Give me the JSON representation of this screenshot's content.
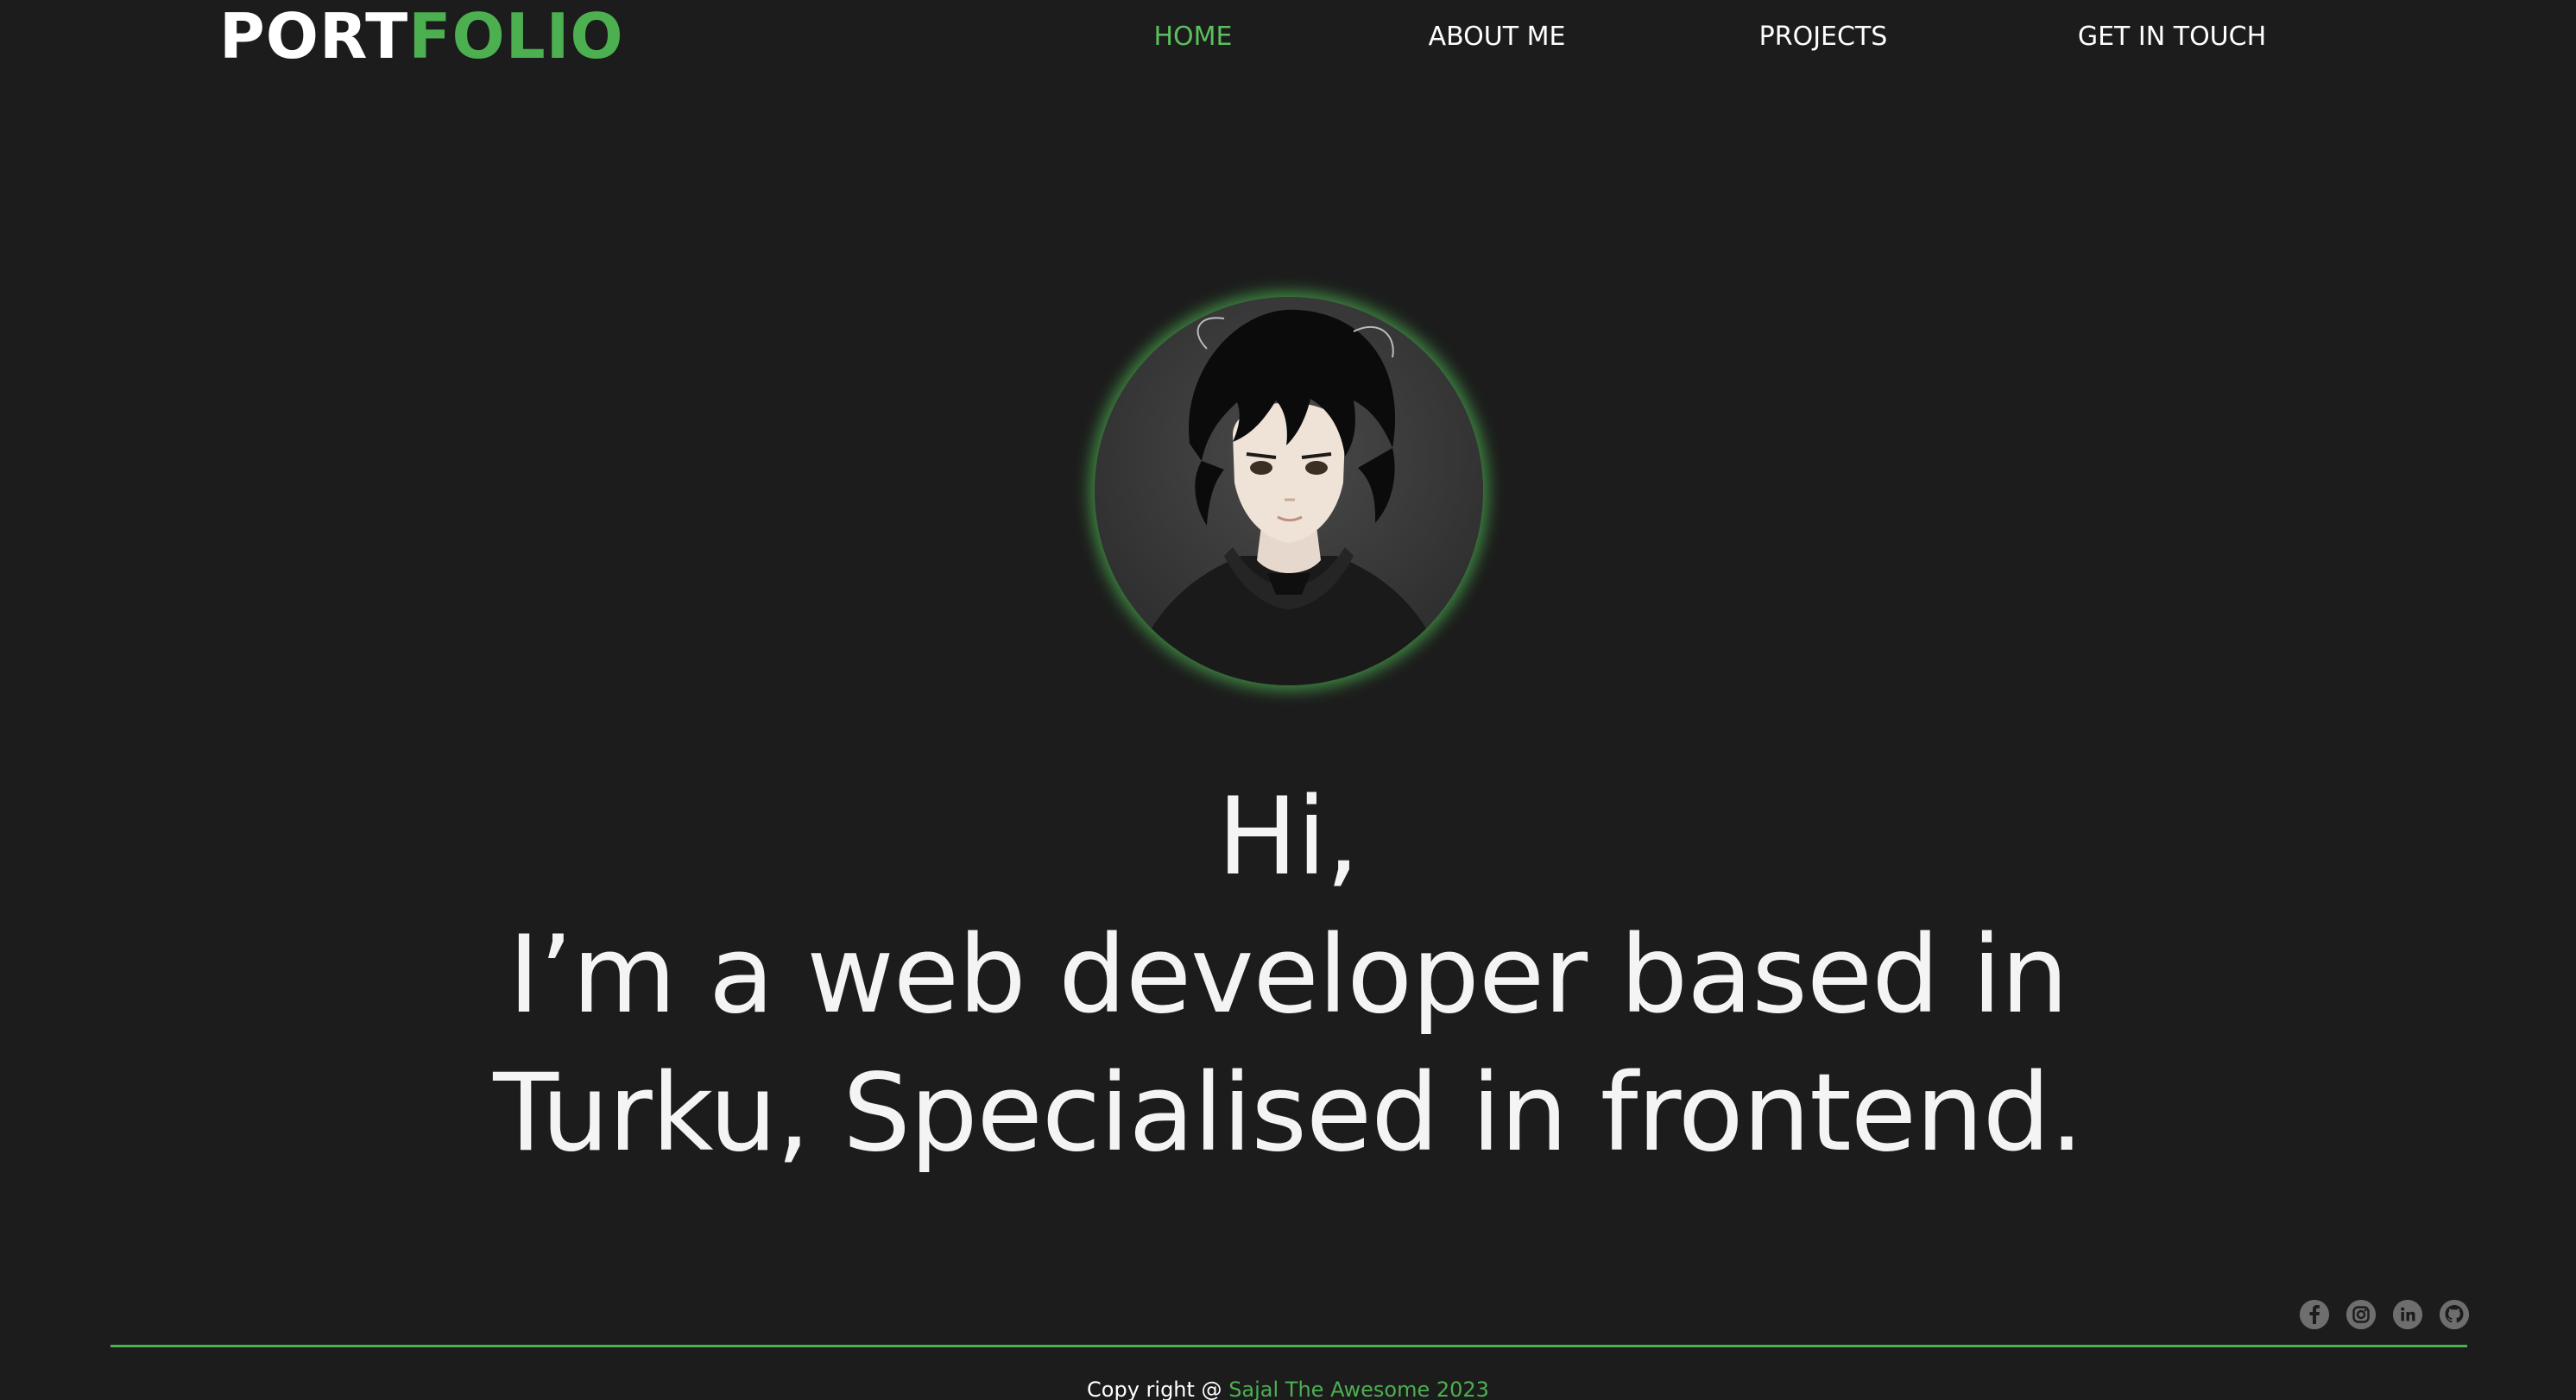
{
  "header": {
    "logo_part_a": "PORT",
    "logo_part_b": "FOLIO",
    "nav": [
      {
        "label": "HOME",
        "active": true
      },
      {
        "label": "ABOUT ME",
        "active": false
      },
      {
        "label": "PROJECTS",
        "active": false
      },
      {
        "label": "GET IN TOUCH",
        "active": false
      }
    ]
  },
  "hero": {
    "line1": "Hi,",
    "line2": "I’m a web developer based in",
    "line3": "Turku, Specialised in frontend."
  },
  "socials": [
    {
      "icon": "facebook-icon"
    },
    {
      "icon": "instagram-icon"
    },
    {
      "icon": "linkedin-icon"
    },
    {
      "icon": "github-icon"
    }
  ],
  "footer": {
    "copyright_prefix": "Copy right @ ",
    "owner": "Sajal The Awesome 2023"
  },
  "colors": {
    "accent": "#4caf50",
    "background": "#1c1c1c",
    "text": "#ffffff"
  }
}
